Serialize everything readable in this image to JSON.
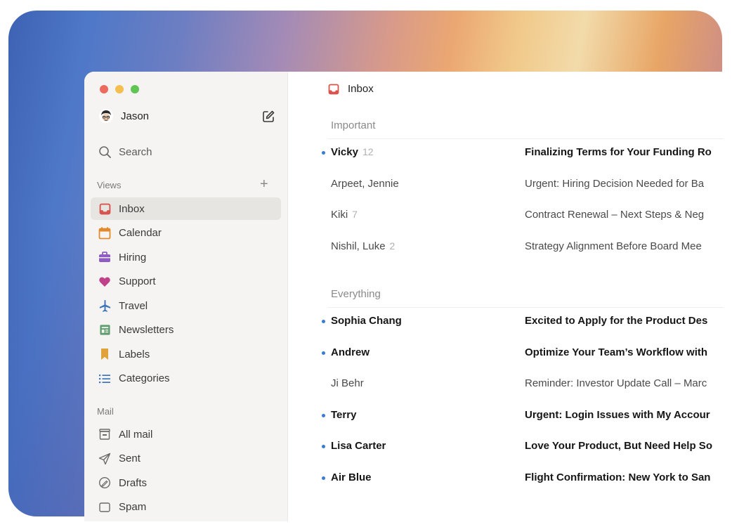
{
  "window": {
    "dots": [
      {
        "name": "close",
        "color": "#ec6a5e"
      },
      {
        "name": "minimize",
        "color": "#f4bf4f"
      },
      {
        "name": "zoom",
        "color": "#61c554"
      }
    ]
  },
  "sidebar": {
    "user": {
      "name": "Jason"
    },
    "search": {
      "label": "Search"
    },
    "views_header": "Views",
    "views": [
      {
        "label": "Inbox",
        "icon": "inbox-icon",
        "color": "#d9534f",
        "active": true
      },
      {
        "label": "Calendar",
        "icon": "calendar-icon",
        "color": "#e28a2b"
      },
      {
        "label": "Hiring",
        "icon": "briefcase-icon",
        "color": "#8e5cc4"
      },
      {
        "label": "Support",
        "icon": "heart-icon",
        "color": "#c0418a"
      },
      {
        "label": "Travel",
        "icon": "airplane-icon",
        "color": "#3d75b8"
      },
      {
        "label": "Newsletters",
        "icon": "newspaper-icon",
        "color": "#5f9e6e"
      },
      {
        "label": "Labels",
        "icon": "bookmark-icon",
        "color": "#e0a23a"
      },
      {
        "label": "Categories",
        "icon": "list-icon",
        "color": "#3d75b8"
      }
    ],
    "mail_header": "Mail",
    "mail": [
      {
        "label": "All mail",
        "icon": "archive-icon"
      },
      {
        "label": "Sent",
        "icon": "send-icon"
      },
      {
        "label": "Drafts",
        "icon": "draft-icon"
      },
      {
        "label": "Spam",
        "icon": "spam-icon"
      }
    ]
  },
  "main": {
    "title": "Inbox",
    "important_header": "Important",
    "everything_header": "Everything",
    "important": [
      {
        "from": "Vicky",
        "count": "12",
        "subject": "Finalizing Terms for Your Funding Ro",
        "unread": true
      },
      {
        "from": "Arpeet, Jennie",
        "count": "",
        "subject": "Urgent: Hiring Decision Needed for Ba",
        "unread": false
      },
      {
        "from": "Kiki",
        "count": "7",
        "subject": "Contract Renewal – Next Steps & Neg",
        "unread": false
      },
      {
        "from": "Nishil, Luke",
        "count": "2",
        "subject": "Strategy Alignment Before Board Mee",
        "unread": false
      }
    ],
    "everything": [
      {
        "from": "Sophia Chang",
        "count": "",
        "subject": "Excited to Apply for the Product Des",
        "unread": true
      },
      {
        "from": "Andrew",
        "count": "",
        "subject": "Optimize Your Team’s Workflow with",
        "unread": true
      },
      {
        "from": "Ji Behr",
        "count": "",
        "subject": "Reminder: Investor Update Call – Marc",
        "unread": false
      },
      {
        "from": "Terry",
        "count": "",
        "subject": "Urgent: Login Issues with My Accour",
        "unread": true
      },
      {
        "from": "Lisa Carter",
        "count": "",
        "subject": "Love Your Product, But Need Help So",
        "unread": true
      },
      {
        "from": "Air Blue",
        "count": "",
        "subject": "Flight Confirmation: New York to San",
        "unread": true
      }
    ]
  }
}
